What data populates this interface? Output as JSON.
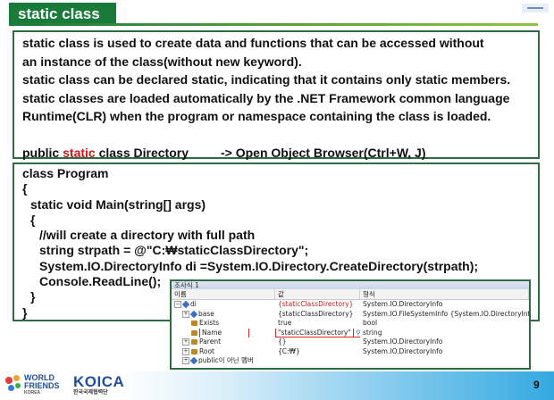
{
  "slide": {
    "title": "static class",
    "page_number": "9"
  },
  "description": {
    "lines": [
      "static class is used to create data and functions that can be accessed without",
      "an instance of the class(without new keyword).",
      "static class can be declared static, indicating that it contains only static members.",
      "static classes are loaded automatically by the .NET Framework common language",
      "Runtime(CLR) when the program or namespace containing the class is loaded."
    ],
    "example_prefix": "public ",
    "example_keyword": "static",
    "example_suffix": " class Directory",
    "example_hint": "-> Open Object Browser(Ctrl+W, J)"
  },
  "code": {
    "lines": [
      "class Program",
      "{",
      "static void Main(string[] args)",
      "{",
      "//will create a directory with full path",
      "string strpath = @\"C:₩staticClassDirectory\";",
      "System.IO.DirectoryInfo di =System.IO.Directory.CreateDirectory(strpath);",
      "Console.ReadLine();",
      "}",
      "}"
    ]
  },
  "watch": {
    "title": "조사식 1",
    "columns": [
      "이름",
      "값",
      "형식"
    ],
    "rows": [
      {
        "name": "di",
        "value": "{staticClassDirectory}",
        "type": "System.IO.DirectoryInfo"
      },
      {
        "name": "base",
        "value": "{staticClassDirectory}",
        "type": "System.IO.FileSystemInfo {System.IO.DirectoryInfo}"
      },
      {
        "name": "Exists",
        "value": "true",
        "type": "bool"
      },
      {
        "name": "Name",
        "value": "\"staticClassDirectory\"",
        "type": "string"
      },
      {
        "name": "Parent",
        "value": "{}",
        "type": "System.IO.DirectoryInfo"
      },
      {
        "name": "Root",
        "value": "{C:₩}",
        "type": "System.IO.DirectoryInfo"
      },
      {
        "name": "public이 아닌 멤버",
        "value": "",
        "type": ""
      }
    ]
  },
  "footer": {
    "wf_line1": "WORLD",
    "wf_line2": "FRIENDS",
    "wf_sub": "KOREA",
    "koica": "KOICA",
    "koica_sub": "한국국제협력단"
  },
  "colors": {
    "accent": "#1a7a3a",
    "keyword": "#d01818",
    "watch_border": "#2f6b44"
  }
}
